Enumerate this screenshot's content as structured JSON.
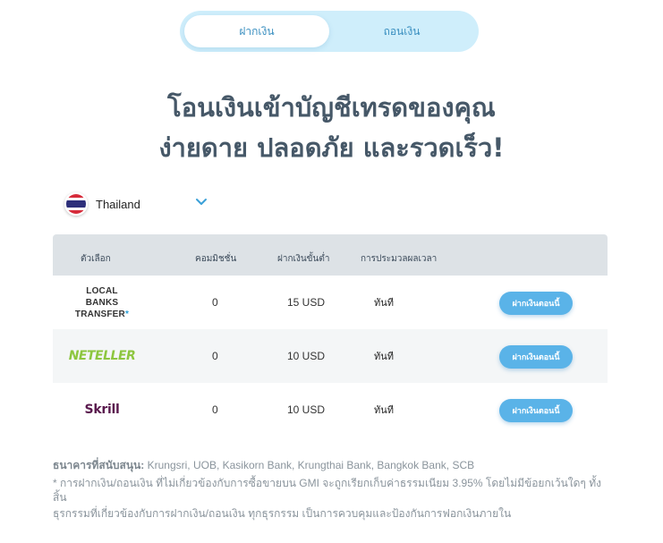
{
  "tabs": [
    {
      "label": "ฝากเงิน",
      "active": true
    },
    {
      "label": "ถอนเงิน",
      "active": false
    }
  ],
  "headline": {
    "line1": "โอนเงินเข้าบัญชีเทรดของคุณ",
    "line2": "ง่ายดาย ปลอดภัย และรวดเร็ว!"
  },
  "country": {
    "name": "Thailand",
    "flag_colors": [
      "#d62b3a",
      "#ffffff",
      "#2d2f7a",
      "#ffffff",
      "#d62b3a"
    ]
  },
  "table": {
    "headers": {
      "option": "ตัวเลือก",
      "commission": "คอมมิชชั่น",
      "min_deposit": "ฝากเงินขั้นต่ำ",
      "processing": "การประมวลผลเวลา"
    },
    "rows": [
      {
        "method_line1": "LOCAL BANKS",
        "method_line2": "TRANSFER",
        "method_star": "*",
        "commission": "0",
        "min_deposit": "15 USD",
        "processing": "ทันที",
        "button": "ฝากเงินตอนนี้"
      },
      {
        "method": "NETELLER",
        "commission": "0",
        "min_deposit": "10 USD",
        "processing": "ทันที",
        "button": "ฝากเงินตอนนี้"
      },
      {
        "method": "Skrill",
        "commission": "0",
        "min_deposit": "10 USD",
        "processing": "ทันที",
        "button": "ฝากเงินตอนนี้"
      }
    ]
  },
  "notes": {
    "banks_label": "ธนาคารที่สนับสนุน:",
    "banks_list": " Krungsri, UOB, Kasikorn Bank, Krungthai Bank, Bangkok Bank, SCB",
    "fee_note": "* การฝากเงิน/ถอนเงิน ที่ไม่เกี่ยวข้องกับการซื้อขายบน GMI จะถูกเรียกเก็บค่าธรรมเนียม 3.95% โดยไม่มีข้อยกเว้นใดๆ ทั้งสิ้น",
    "aml_note": "ธุรกรรมที่เกี่ยวข้องกับการฝากเงิน/ถอนเงิน ทุกธุรกรรม เป็นการควบคุมและป้องกันการฟอกเงินภายใน"
  },
  "colors": {
    "accent": "#5ab3e8",
    "tab_bg": "#cfeefb",
    "header_bg": "#dde2e6",
    "neteller_green": "#8dc63f",
    "skrill_purple": "#5a1a4e"
  }
}
